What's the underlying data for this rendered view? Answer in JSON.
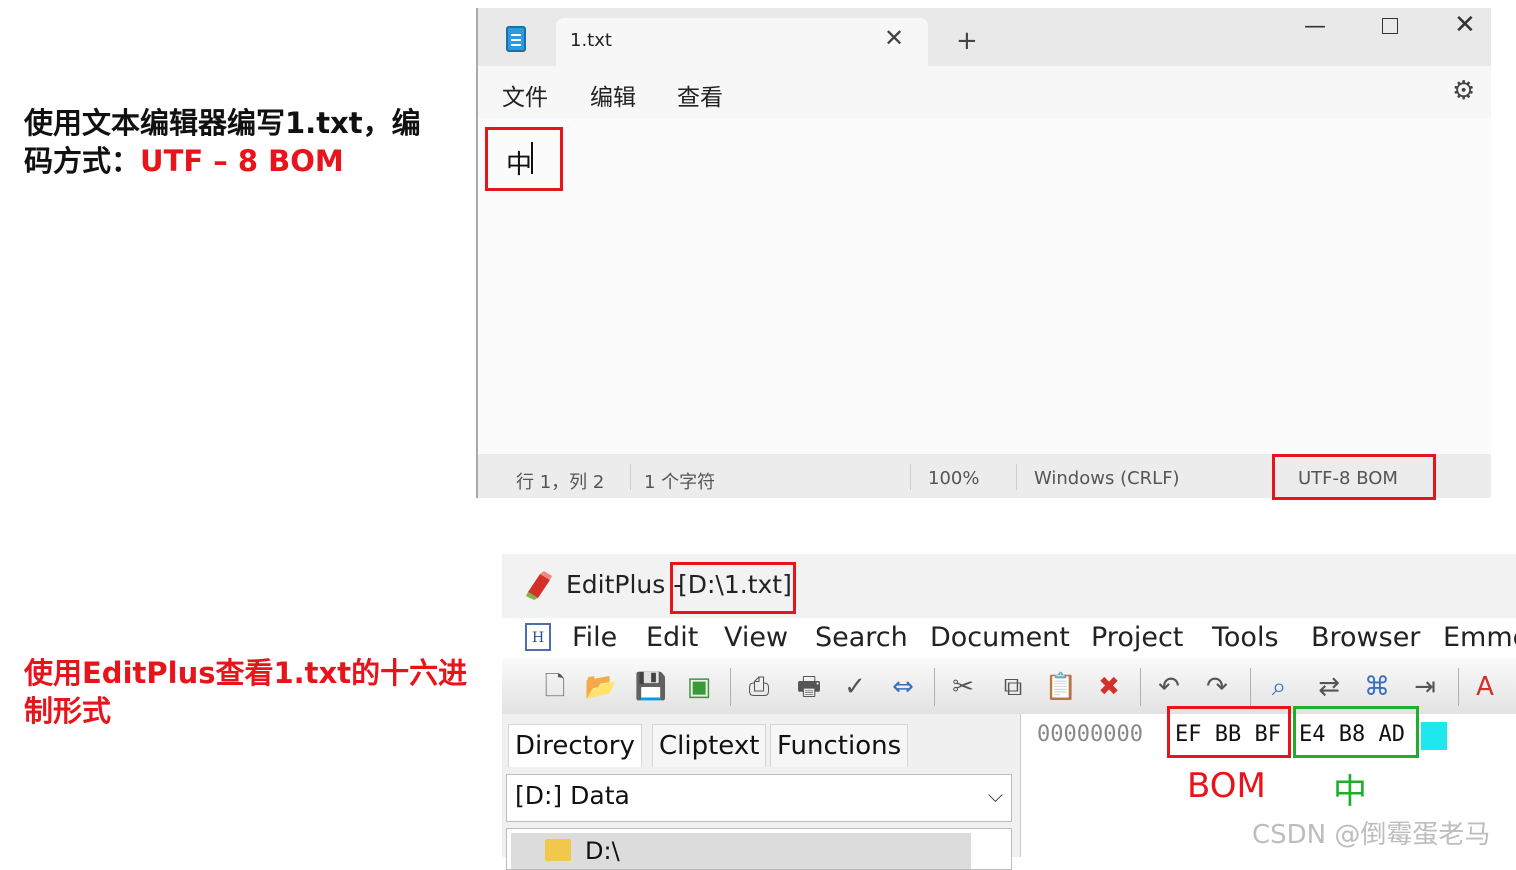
{
  "captions": {
    "top_line1": "使用文本编辑器编写1.txt，编",
    "top_line2_prefix": "码方式：",
    "top_line2_highlight": "UTF – 8 BOM",
    "bottom_line1": "使用EditPlus查看1.txt的十六进",
    "bottom_line2": "制形式"
  },
  "notepad": {
    "tab_title": "1.txt",
    "tab_close": "✕",
    "new_tab": "+",
    "min": "—",
    "close": "✕",
    "menu": [
      "文件",
      "编辑",
      "查看"
    ],
    "gear": "⚙",
    "content": "中",
    "status": {
      "position": "行 1，列 2",
      "chars": "1 个字符",
      "zoom": "100%",
      "line_ending": "Windows (CRLF)",
      "encoding": "UTF-8 BOM"
    }
  },
  "editplus": {
    "title": "EditPlus -",
    "path": "[D:\\1.txt]",
    "menu": [
      "File",
      "Edit",
      "View",
      "Search",
      "Document",
      "Project",
      "Tools",
      "Browser",
      "Emme"
    ],
    "tabs": [
      "Directory",
      "Cliptext",
      "Functions"
    ],
    "drive": "[D:] Data",
    "tree_item": "D:\\",
    "hex": {
      "address": "00000000",
      "bom_bytes": "EF  BB  BF",
      "char_bytes": "E4  B8  AD"
    },
    "annotations": {
      "bom": "BOM",
      "char": "中"
    }
  },
  "watermark": "CSDN @倒霉蛋老马",
  "colors": {
    "highlight_red": "#e8141b",
    "highlight_green": "#1fae2b",
    "cursor_cyan": "#1ee8ee"
  }
}
